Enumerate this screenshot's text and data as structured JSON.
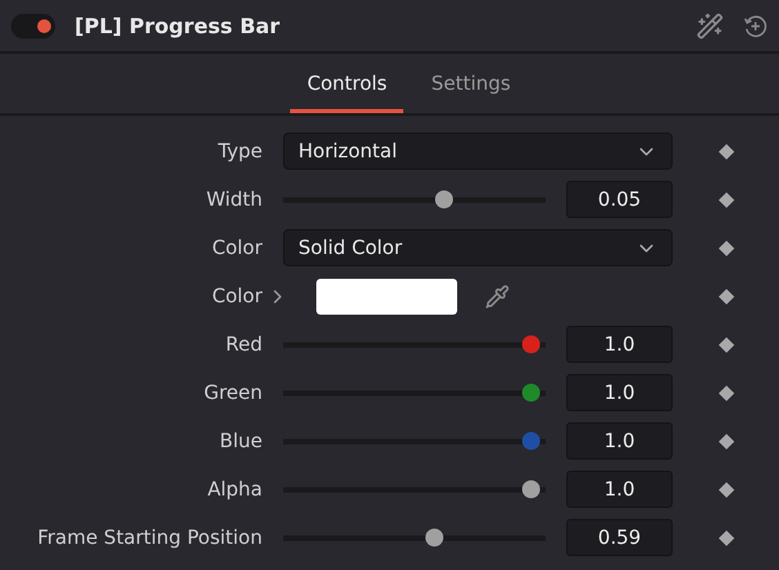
{
  "header": {
    "title": "[PL] Progress Bar",
    "enabled": true
  },
  "tabs": [
    {
      "label": "Controls",
      "selected": true
    },
    {
      "label": "Settings",
      "selected": false
    }
  ],
  "rows": [
    {
      "kind": "dropdown",
      "label": "Type",
      "value": "Horizontal"
    },
    {
      "kind": "slider",
      "label": "Width",
      "level": 0.62,
      "value": "0.05",
      "color": "#a0a0a0"
    },
    {
      "kind": "dropdown",
      "label": "Color",
      "value": "Solid Color"
    },
    {
      "kind": "swatch",
      "label": "Color",
      "color": "#ffffff"
    },
    {
      "kind": "slider",
      "label": "Red",
      "level": 0.97,
      "value": "1.0",
      "color": "#d9211c"
    },
    {
      "kind": "slider",
      "label": "Green",
      "level": 0.97,
      "value": "1.0",
      "color": "#1e8a2a"
    },
    {
      "kind": "slider",
      "label": "Blue",
      "level": 0.97,
      "value": "1.0",
      "color": "#1f4fa3"
    },
    {
      "kind": "slider",
      "label": "Alpha",
      "level": 0.97,
      "value": "1.0",
      "color": "#a0a0a0"
    },
    {
      "kind": "slider",
      "label": "Frame Starting Position",
      "level": 0.58,
      "value": "0.59",
      "color": "#a0a0a0"
    }
  ]
}
